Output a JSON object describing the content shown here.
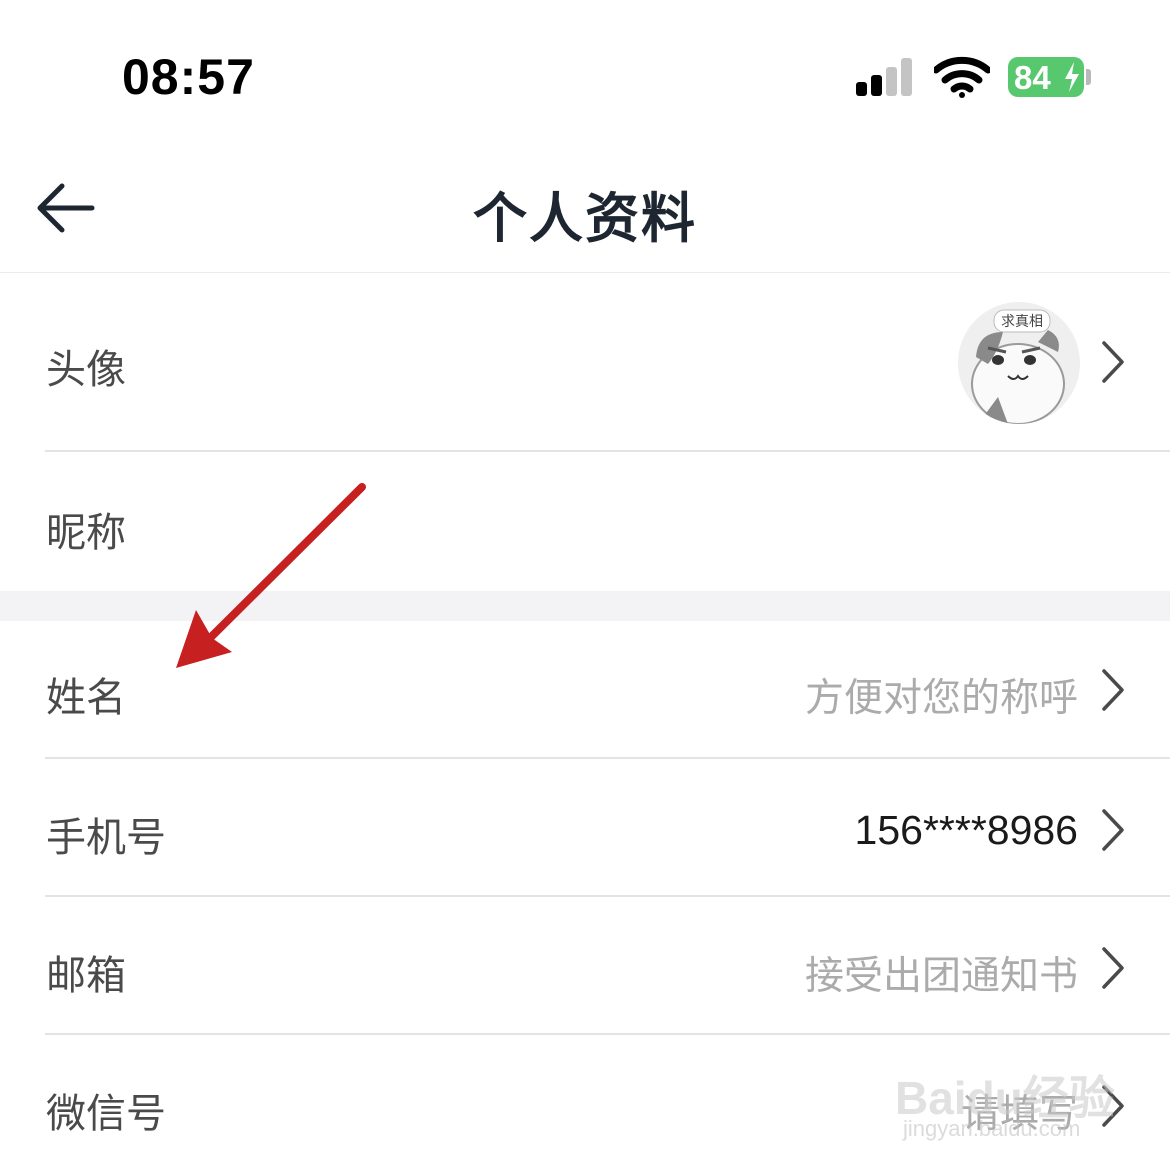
{
  "status_bar": {
    "time": "08:57",
    "battery_percent": "84",
    "battery_color": "#57c86d",
    "signal_bars_active": 2,
    "signal_bars_total": 4,
    "icons": [
      "signal-icon",
      "wifi-icon",
      "battery-charging-icon"
    ]
  },
  "nav": {
    "title": "个人资料",
    "back_icon": "arrow-left-icon"
  },
  "profile_rows": [
    {
      "label": "头像",
      "value": "",
      "type": "avatar"
    },
    {
      "label": "昵称",
      "value": ""
    },
    {
      "label": "姓名",
      "value": "方便对您的称呼",
      "placeholder": true
    },
    {
      "label": "手机号",
      "value": "156****8986",
      "placeholder": false
    },
    {
      "label": "邮箱",
      "value": "接受出团通知书",
      "placeholder": true
    },
    {
      "label": "微信号",
      "value": "请填写",
      "placeholder": true
    }
  ],
  "avatar": {
    "badge_text": "求真相"
  },
  "annotation": {
    "color": "#c62020",
    "target": "姓名"
  },
  "watermark": {
    "brand": "Baidu经验",
    "url": "jingyan.baidu.com"
  }
}
